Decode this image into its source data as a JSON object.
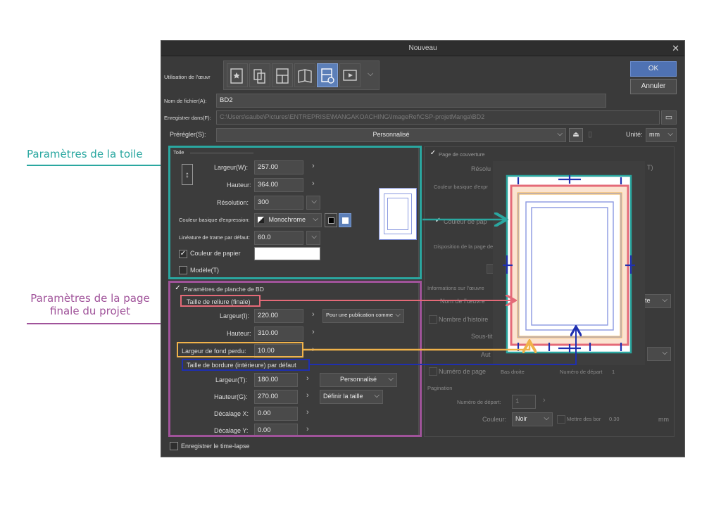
{
  "annotations": {
    "toile": {
      "text": "Paramètres de la toile",
      "color": "#2aa7a0"
    },
    "page": {
      "line1": "Paramètres de la page",
      "line2": "finale du projet",
      "color": "#a0539a"
    }
  },
  "dialog": {
    "title": "Nouveau",
    "utilisation_label": "Utilisation de l'œuvr",
    "filename_label": "Nom de fichier(A):",
    "filename_value": "BD2",
    "save_label": "Enregistrer dans(F):",
    "save_path": "C:\\Users\\saube\\Pictures\\ENTREPRISE\\MANGAKOACHING\\ImageRef\\CSP-projetManga\\BD2",
    "preset_label": "Prérégler(S):",
    "preset_value": "Personnalisé",
    "unit_label": "Unité:",
    "unit_value": "mm",
    "ok": "OK",
    "cancel": "Annuler",
    "timelapse": "Enregistrer le time-lapse"
  },
  "toile": {
    "section": "Toile",
    "width_label": "Largeur(W):",
    "width_value": "257.00",
    "height_label": "Hauteur:",
    "height_value": "364.00",
    "res_label": "Résolution:",
    "res_value": "300",
    "color_label": "Couleur basique d'expression:",
    "color_value": "Monochrome",
    "lineature_label": "Linéature de trame par défaut:",
    "lineature_value": "60.0",
    "paper_label": "Couleur de papier",
    "model_label": "Modèle(T)"
  },
  "planche": {
    "section": "Paramètres de planche de BD",
    "reliure_label": "Taille de reliure (finale)",
    "width_label": "Largeur(I):",
    "width_value": "220.00",
    "pub_value": "Pour une publication comme",
    "height_label": "Hauteur:",
    "height_value": "310.00",
    "bleed_label": "Largeur de fond perdu:",
    "bleed_value": "10.00",
    "border_label": "Taille de bordure (intérieure) par défaut",
    "bwidth_label": "Largeur(T):",
    "bwidth_value": "180.00",
    "bwidth_preset": "Personnalisé",
    "bheight_label": "Hauteur(G):",
    "bheight_value": "270.00",
    "bheight_preset": "Définir la taille",
    "offx_label": "Décalage X:",
    "offx_value": "0.00",
    "offy_label": "Décalage Y:",
    "offy_value": "0.00"
  },
  "right": {
    "cover": "Page de couverture",
    "resol": "Résolu",
    "couleur": "Couleur basique d'expr",
    "couleur_pap": "Couleur de pap",
    "dispo": "Disposition de la page de",
    "info": "Informations sur l'œuvre",
    "nom": "Nom de l'œuvre",
    "nombre": "Nombre d'histoire",
    "sous": "Sous-titr",
    "auteur": "Aut",
    "numero": "Numéro de page",
    "bas": "Bas droite",
    "num_depart": "Numéro de départ",
    "pagination": "Pagination",
    "num_depart2": "Numéro de départ:",
    "num_val": "1",
    "num_val2": "1",
    "couleur2": "Couleur:",
    "noir": "Noir",
    "mettre": "Mettre des bor",
    "val": "0.30",
    "mm": "mm",
    "t_right": "T)",
    "ite": "ite"
  },
  "colors": {
    "teal": "#2aa7a0",
    "purple": "#a0539a",
    "red": "#e46a78",
    "orange": "#f0b24a",
    "blue": "#1f2fb0"
  }
}
